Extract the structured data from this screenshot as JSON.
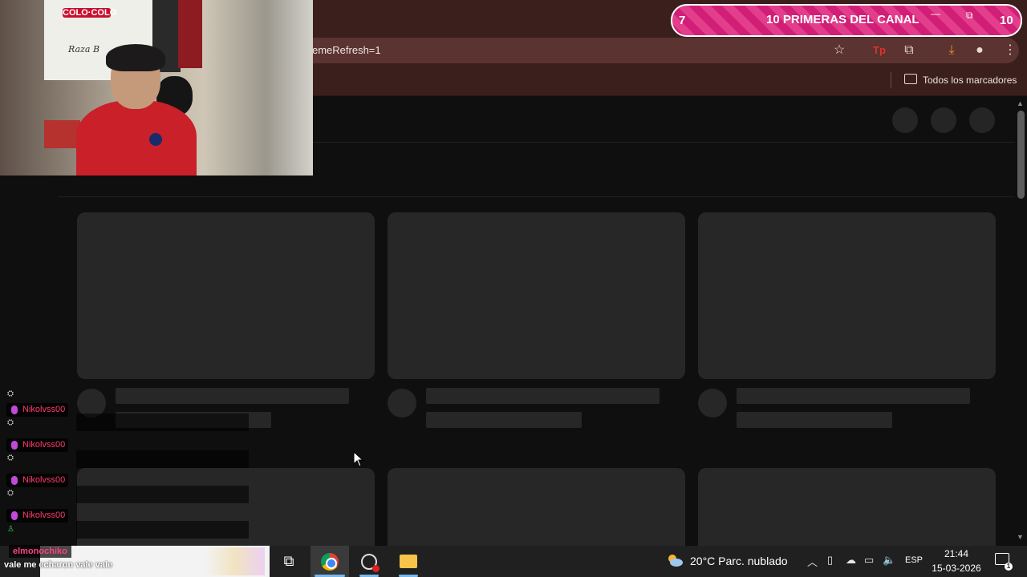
{
  "browser": {
    "url_fragment": "emeRefresh=1",
    "bookmarks_all_label": "Todos los marcadores"
  },
  "alert": {
    "left_number": "7",
    "title": "10 PRIMERAS DEL CANAL",
    "right_number": "10"
  },
  "webcam": {
    "flag_text": "COLO·COLO",
    "flag_motto": "Raza B"
  },
  "chat": {
    "messages": [
      {
        "user": "Nikolvss00"
      },
      {
        "user": "Nikolvss00"
      },
      {
        "user": "Nikolvss00"
      },
      {
        "user": "Nikolvss00"
      }
    ],
    "last_user": "elmonochiko",
    "last_message": "vale me echaron vale vale"
  },
  "taskbar": {
    "weather_temp_text": "20°C  Parc. nublado",
    "language": "ESP",
    "time": "21:44",
    "date": "15-03-2026",
    "notification_count": "1"
  },
  "colors": {
    "chrome_frame": "#3a1f1c",
    "skeleton": "#272727",
    "page_bg": "#0f0f0f",
    "alert_pink": "#d11e77",
    "chat_username": "#ff3b6a"
  }
}
